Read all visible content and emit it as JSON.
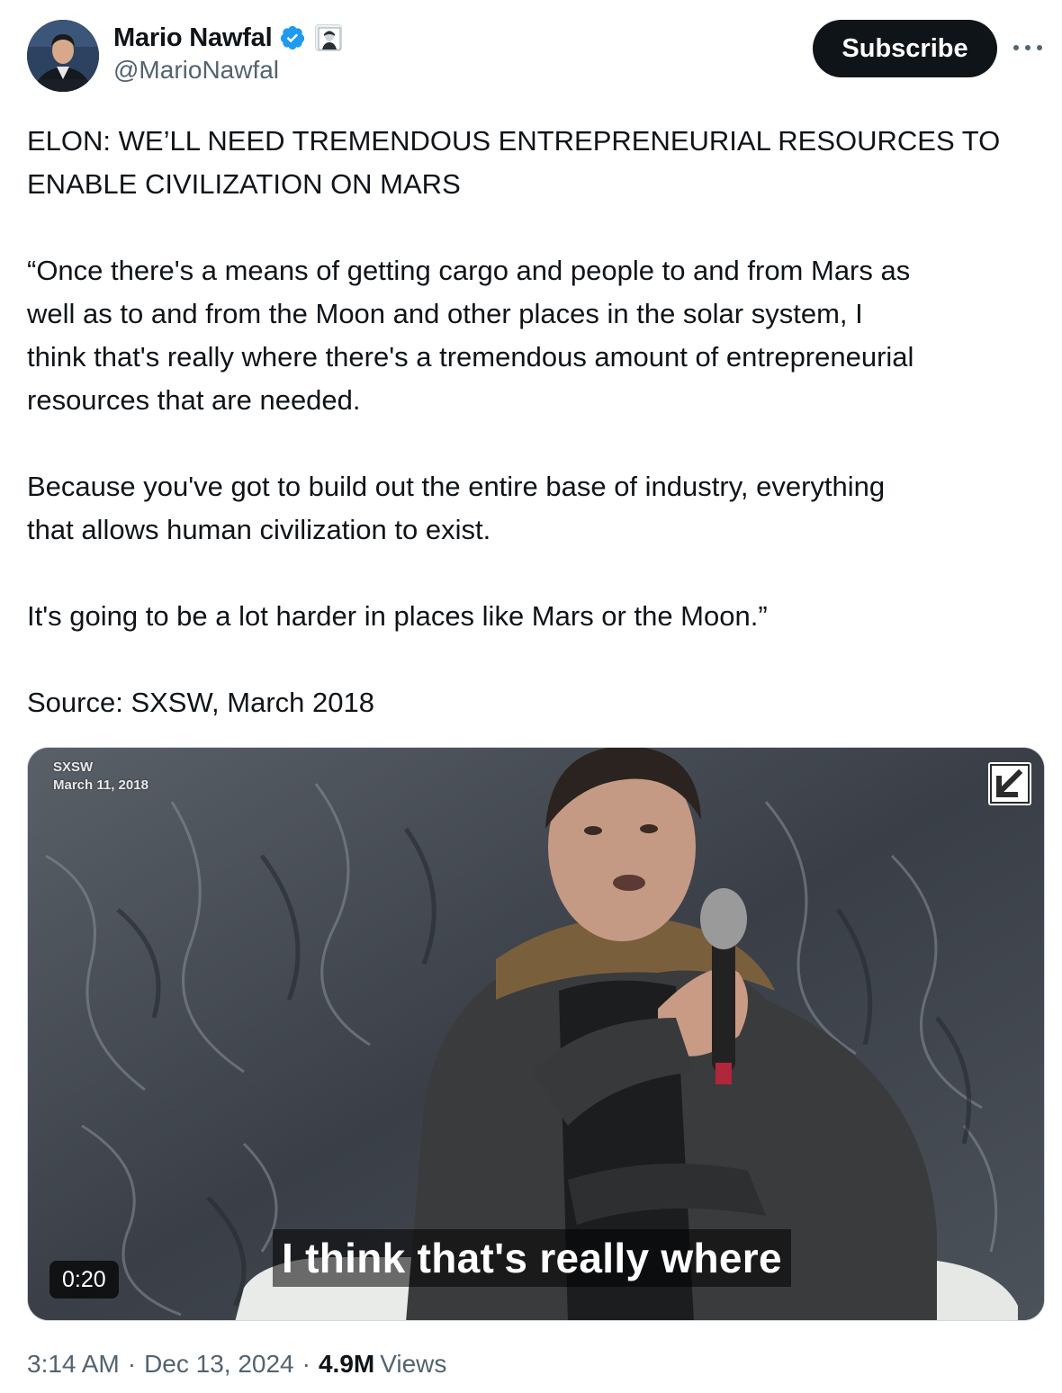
{
  "author": {
    "display_name": "Mario Nawfal",
    "handle": "@MarioNawfal",
    "verified_color": "#1d9bf0"
  },
  "header": {
    "subscribe_label": "Subscribe",
    "more_icon": "more-horizontal-icon"
  },
  "tweet": {
    "headline_line1": "ELON: WE’LL NEED TREMENDOUS ENTREPRENEURIAL RESOURCES TO",
    "headline_line2": "ENABLE CIVILIZATION ON MARS",
    "quote_line1": "“Once there's a means of getting cargo and people to and from Mars as",
    "quote_line2": "well as to and from the Moon and other places in the solar system, I",
    "quote_line3": "think that's really where there's a tremendous amount of entrepreneurial",
    "quote_line4": "resources that are needed.",
    "para2_line1": "Because you've got to build out the entire base of industry, everything",
    "para2_line2": "that allows human civilization to exist.",
    "para3": "It's going to be a lot harder in places like Mars or the Moon.”",
    "source": "Source: SXSW, March 2018"
  },
  "media": {
    "watermark_line1": "SXSW",
    "watermark_line2": "March 11, 2018",
    "caption": "I think that's really where",
    "duration": "0:20"
  },
  "footer": {
    "time": "3:14 AM",
    "separator": "·",
    "date": "Dec 13, 2024",
    "views_count": "4.9M",
    "views_label": "Views"
  }
}
